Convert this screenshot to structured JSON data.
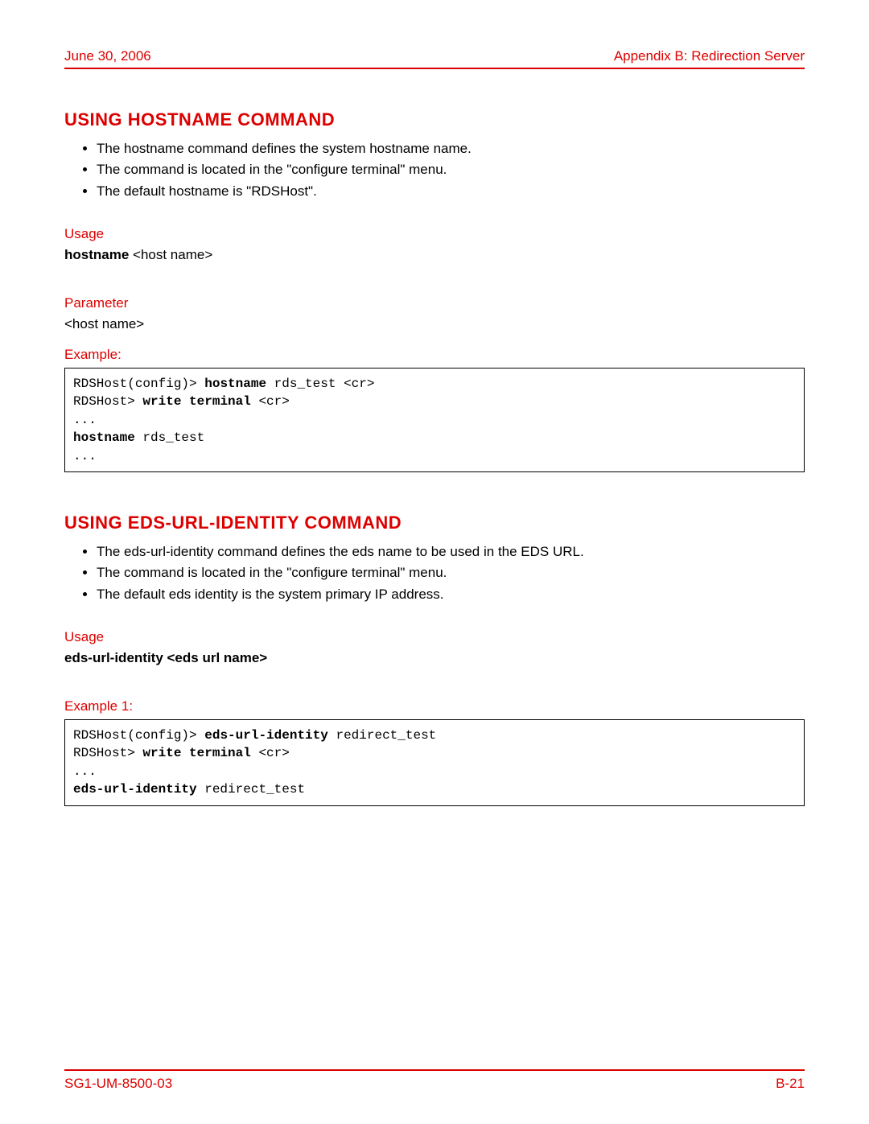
{
  "header": {
    "left": "June 30, 2006",
    "right": "Appendix B: Redirection Server"
  },
  "section1": {
    "title": "USING HOSTNAME COMMAND",
    "bullets": [
      "The hostname command defines the system hostname name.",
      "The command is located in the \"configure terminal\" menu.",
      "The default hostname is \"RDSHost\"."
    ],
    "usage_label": "Usage",
    "usage_bold": "hostname",
    "usage_rest": " <host name>",
    "param_label": "Parameter",
    "param_text": "<host name>",
    "example_label": "Example:",
    "code": {
      "l1a": "RDSHost(config)> ",
      "l1b": "hostname",
      "l1c": " rds_test <cr>",
      "l2a": "RDSHost> ",
      "l2b": "write terminal",
      "l2c": " <cr>",
      "l3": "...",
      "l4a": "hostname",
      "l4b": " rds_test",
      "l5": "..."
    }
  },
  "section2": {
    "title": "USING EDS-URL-IDENTITY COMMAND",
    "bullets": [
      "The eds-url-identity command defines the eds name to be used in the EDS URL.",
      "The command is located in the \"configure terminal\" menu.",
      "The default eds identity is the system primary IP address."
    ],
    "usage_label": "Usage",
    "usage_bold": "eds-url-identity <eds url name>",
    "example_label": "Example 1:",
    "code": {
      "l1a": "RDSHost(config)> ",
      "l1b": "eds-url-identity",
      "l1c": " redirect_test",
      "l2a": "RDSHost> ",
      "l2b": "write terminal",
      "l2c": " <cr>",
      "l3": "...",
      "l4a": "eds-url-identity",
      "l4b": " redirect_test"
    }
  },
  "footer": {
    "left": "SG1-UM-8500-03",
    "right": "B-21"
  }
}
